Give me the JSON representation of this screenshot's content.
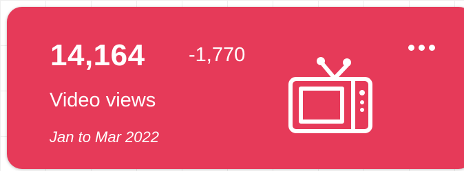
{
  "card": {
    "value": "14,164",
    "change": "-1,770",
    "label": "Video views",
    "period": "Jan to Mar 2022"
  },
  "icons": {
    "illustration": "tv-icon",
    "menu": "more-options-icon"
  },
  "colors": {
    "card_background": "#e63a59",
    "text": "#ffffff"
  }
}
